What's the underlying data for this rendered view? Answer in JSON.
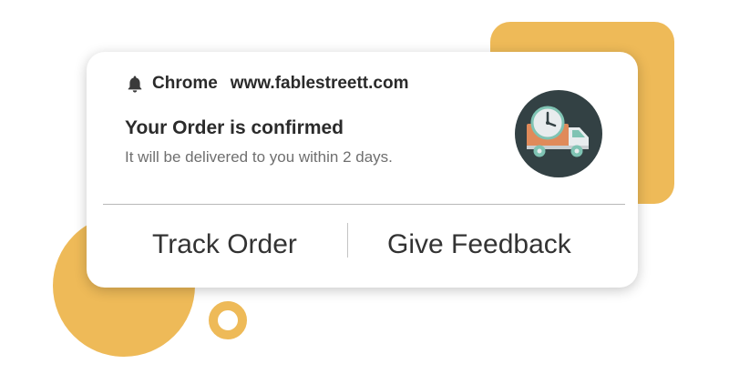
{
  "colors": {
    "accent": "#eeba58",
    "card_bg": "#ffffff",
    "badge_bg": "#334144",
    "truck_orange": "#e08a5a",
    "truck_body": "#e8ecee",
    "truck_teal": "#7fc3b3"
  },
  "notification": {
    "icon": "bell-icon",
    "app_name": "Chrome",
    "url": "www.fablestreett.com",
    "title": "Your Order is confirmed",
    "message": "It will be delivered to you within 2 days.",
    "image_icon": "delivery-truck-clock-icon"
  },
  "actions": {
    "track_label": "Track Order",
    "feedback_label": "Give Feedback"
  }
}
